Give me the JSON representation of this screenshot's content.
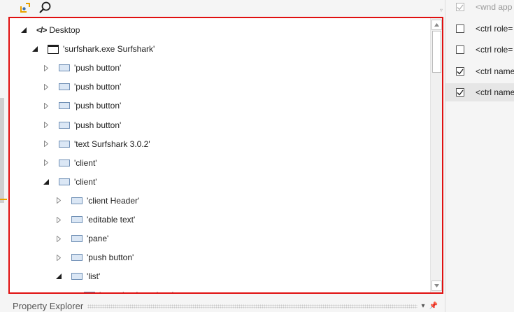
{
  "tree": {
    "nodes": [
      {
        "label": "Desktop",
        "level": 0,
        "expanded": true,
        "icon": "code-icon"
      },
      {
        "label": "'surfshark.exe Surfshark'",
        "level": 1,
        "expanded": true,
        "icon": "window-icon"
      },
      {
        "label": "'push button'",
        "level": 2,
        "expanded": false,
        "icon": "control-icon"
      },
      {
        "label": "'push button'",
        "level": 2,
        "expanded": false,
        "icon": "control-icon"
      },
      {
        "label": "'push button'",
        "level": 2,
        "expanded": false,
        "icon": "control-icon"
      },
      {
        "label": "'push button'",
        "level": 2,
        "expanded": false,
        "icon": "control-icon"
      },
      {
        "label": "'text  Surfshark 3.0.2'",
        "level": 2,
        "expanded": false,
        "icon": "control-icon"
      },
      {
        "label": "'client'",
        "level": 2,
        "expanded": false,
        "icon": "control-icon"
      },
      {
        "label": "'client'",
        "level": 2,
        "expanded": true,
        "icon": "control-icon"
      },
      {
        "label": "'client  Header'",
        "level": 3,
        "expanded": false,
        "icon": "control-icon"
      },
      {
        "label": "'editable text'",
        "level": 3,
        "expanded": false,
        "icon": "control-icon"
      },
      {
        "label": "'pane'",
        "level": 3,
        "expanded": false,
        "icon": "control-icon"
      },
      {
        "label": "'push button'",
        "level": 3,
        "expanded": false,
        "icon": "control-icon"
      },
      {
        "label": "'list'",
        "level": 3,
        "expanded": true,
        "icon": "control-icon"
      },
      {
        "label": "'grouping  Locations'",
        "level": 4,
        "expanded": true,
        "icon": "control-icon"
      }
    ]
  },
  "property_explorer": {
    "title": "Property Explorer"
  },
  "right_list": {
    "rows": [
      {
        "text": "<wnd app",
        "checked": true,
        "dim": true,
        "selected": false
      },
      {
        "text": "<ctrl role=",
        "checked": false,
        "dim": false,
        "selected": false
      },
      {
        "text": "<ctrl role=",
        "checked": false,
        "dim": false,
        "selected": false
      },
      {
        "text": "<ctrl name",
        "checked": true,
        "dim": false,
        "selected": false
      },
      {
        "text": "<ctrl name",
        "checked": true,
        "dim": false,
        "selected": true
      }
    ]
  },
  "colors": {
    "highlight_border": "#e01010",
    "icon_accent": "#e8a200"
  }
}
